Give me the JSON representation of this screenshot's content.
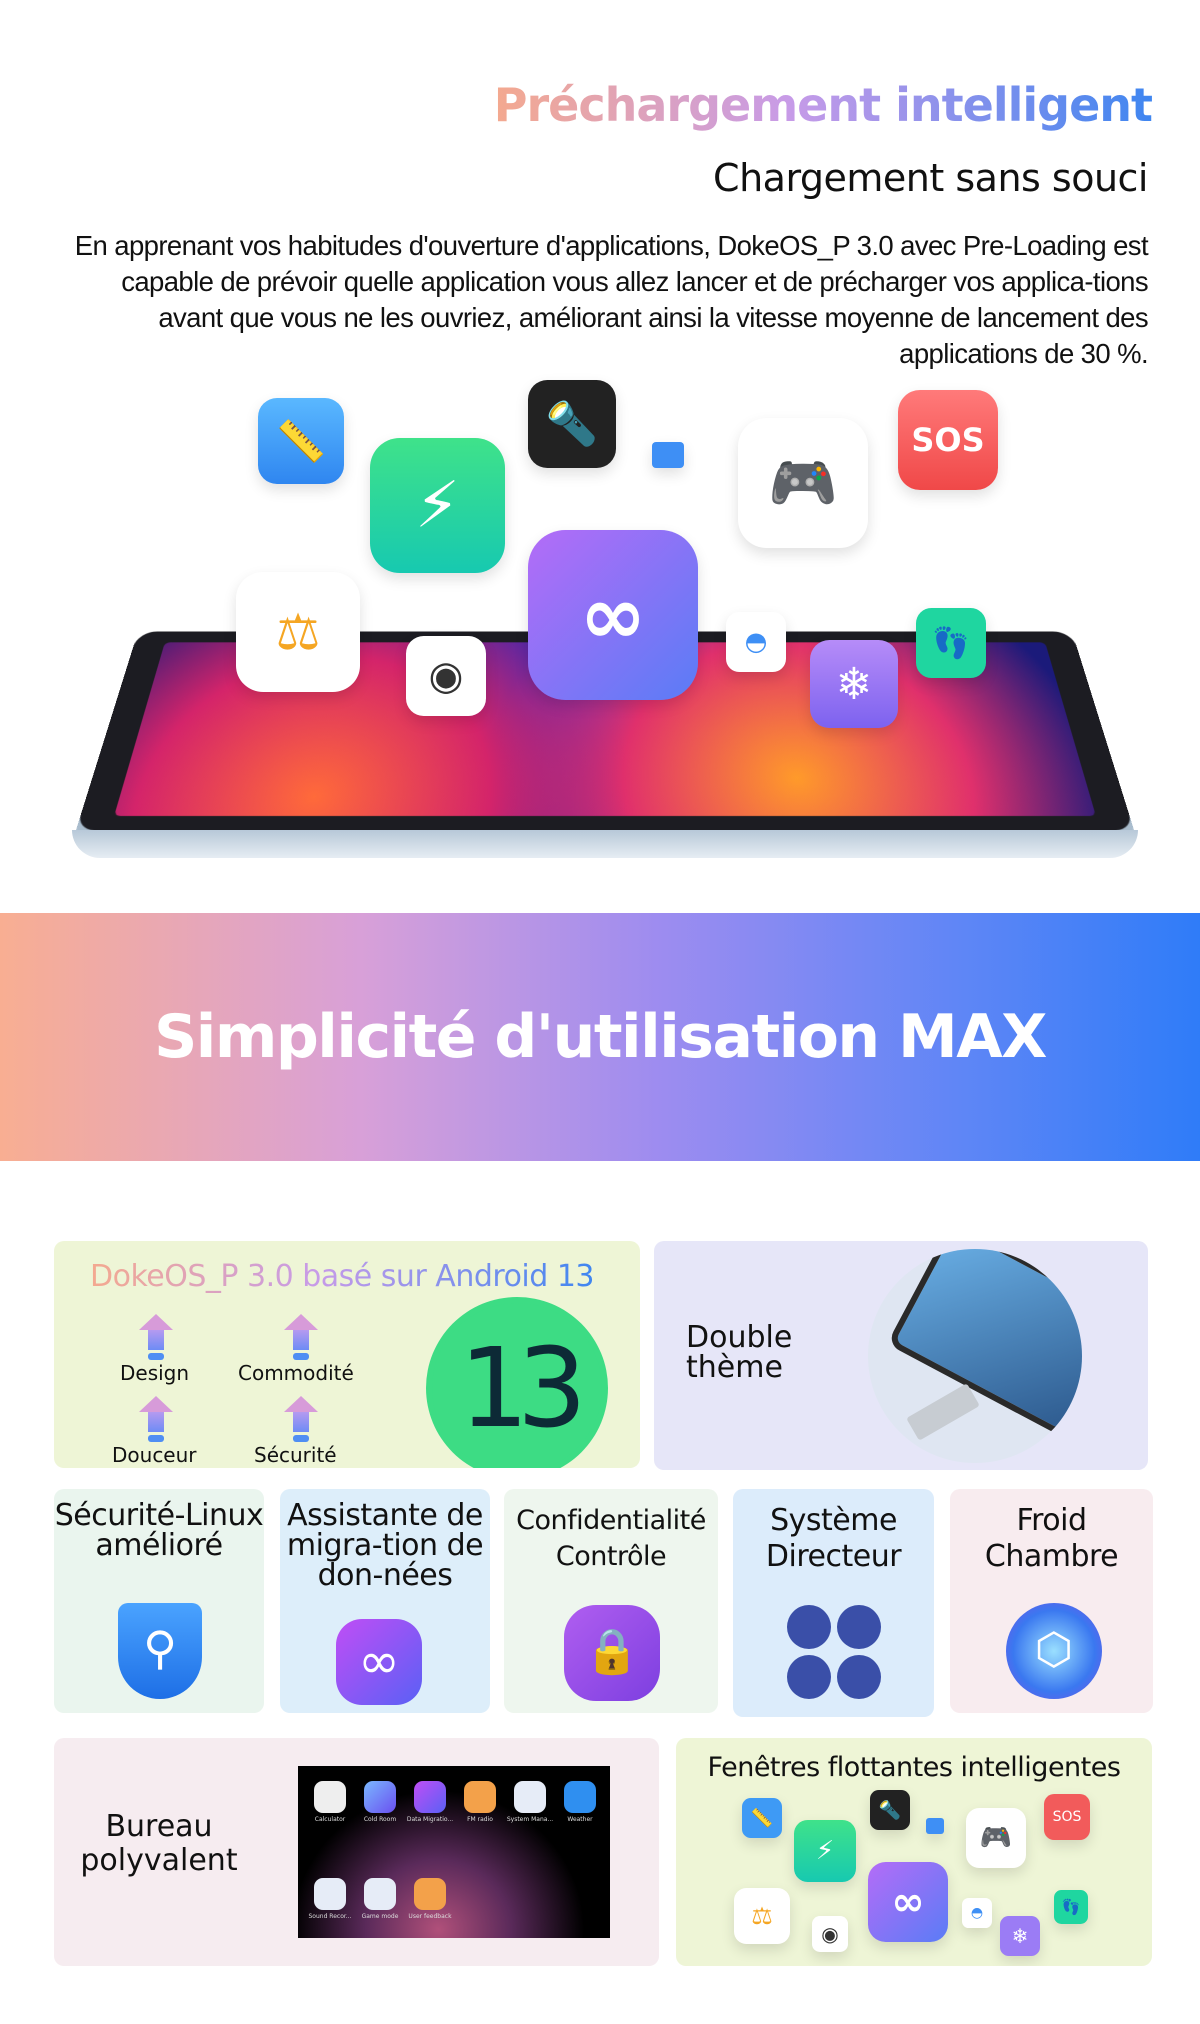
{
  "header": {
    "title": "Préchargement intelligent",
    "subtitle": "Chargement sans souci",
    "paragraph": "En apprenant vos habitudes d'ouverture d'applications, DokeOS_P 3.0 avec Pre-Loading est capable de prévoir quelle application vous allez lancer et de précharger vos applica-tions avant que vous ne les ouvriez, améliorant ainsi la vitesse moyenne de lancement des applications de 30 %."
  },
  "hero_icons": {
    "sos": "SOS"
  },
  "banner": {
    "title": "Simplicité d'utilisation MAX"
  },
  "android_card": {
    "title": "DokeOS_P 3.0 basé sur Android 13",
    "features": [
      "Design",
      "Commodité",
      "Douceur",
      "Sécurité"
    ],
    "badge": "13"
  },
  "theme_card": {
    "title": "Double thème"
  },
  "features": [
    {
      "label": "Sécurité-Linux amélioré",
      "icon": "shield-key-icon"
    },
    {
      "label": "Assistante de migra-tion de don-nées",
      "icon": "data-migration-icon"
    },
    {
      "label": "Confidentialité Contrôle",
      "icon": "privacy-lock-icon"
    },
    {
      "label": "Système Directeur",
      "icon": "four-petal-icon"
    },
    {
      "label": "Froid Chambre",
      "icon": "cube-icon"
    }
  ],
  "bureau_card": {
    "title": "Bureau polyvalent",
    "apps": [
      "Calculator",
      "Cold Room",
      "Data Migratio...",
      "FM radio",
      "System Mana...",
      "Weather",
      "Sound Recor...",
      "Game mode",
      "User feedback"
    ]
  },
  "floating_card": {
    "title": "Fenêtres flottantes intelligentes",
    "sos": "SOS"
  },
  "colors": {
    "title_gradient": [
      "#f4a98f",
      "#c79be8",
      "#3f86f0"
    ],
    "banner_gradient": [
      "#f8ae92",
      "#9d8cf0",
      "#2f7cf8"
    ],
    "android_green": "#3ddc84"
  }
}
